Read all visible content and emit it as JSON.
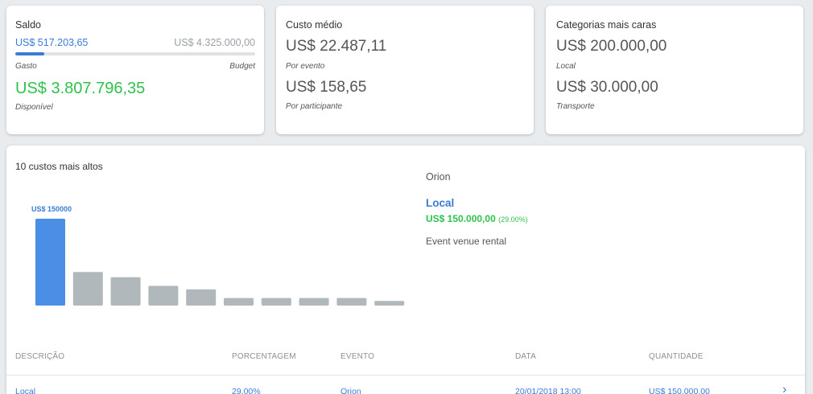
{
  "saldo": {
    "title": "Saldo",
    "spent_value": "US$ 517.203,65",
    "budget_value": "US$ 4.325.000,00",
    "spent_label": "Gasto",
    "budget_label": "Budget",
    "progress_fraction": 0.1196,
    "available_value": "US$ 3.807.796,35",
    "available_label": "Disponível"
  },
  "custo_medio": {
    "title": "Custo médio",
    "per_event_value": "US$ 22.487,11",
    "per_event_label": "Por evento",
    "per_participant_value": "US$ 158,65",
    "per_participant_label": "Por participante"
  },
  "categorias": {
    "title": "Categorias mais caras",
    "first_value": "US$ 200.000,00",
    "first_label": "Local",
    "second_value": "US$ 30.000,00",
    "second_label": "Transporte"
  },
  "top_costs": {
    "title": "10 custos mais altos",
    "selected_label": "US$ 150000",
    "detail": {
      "project": "Orion",
      "category": "Local",
      "amount": "US$ 150.000,00",
      "percent": "(29.00%)",
      "description": "Event venue rental"
    }
  },
  "chart_data": {
    "type": "bar",
    "values": [
      150000,
      58000,
      49000,
      34000,
      28000,
      13000,
      13000,
      13000,
      13000,
      8000
    ],
    "highlight_index": 0,
    "colors": {
      "highlight": "#4a8ee6",
      "default": "#b0b8bc"
    },
    "data_labels": [
      "US$ 150000"
    ]
  },
  "table": {
    "headers": [
      "DESCRIÇÃO",
      "PORCENTAGEM",
      "EVENTO",
      "DATA",
      "QUANTIDADE"
    ],
    "rows": [
      [
        "Local",
        "29.00%",
        "Orion",
        "20/01/2018 13:00",
        "US$ 150.000,00"
      ]
    ]
  },
  "colors": {
    "accent_blue": "#3a7bd5",
    "accent_green": "#2ec24c",
    "background": "#e9ecee"
  }
}
